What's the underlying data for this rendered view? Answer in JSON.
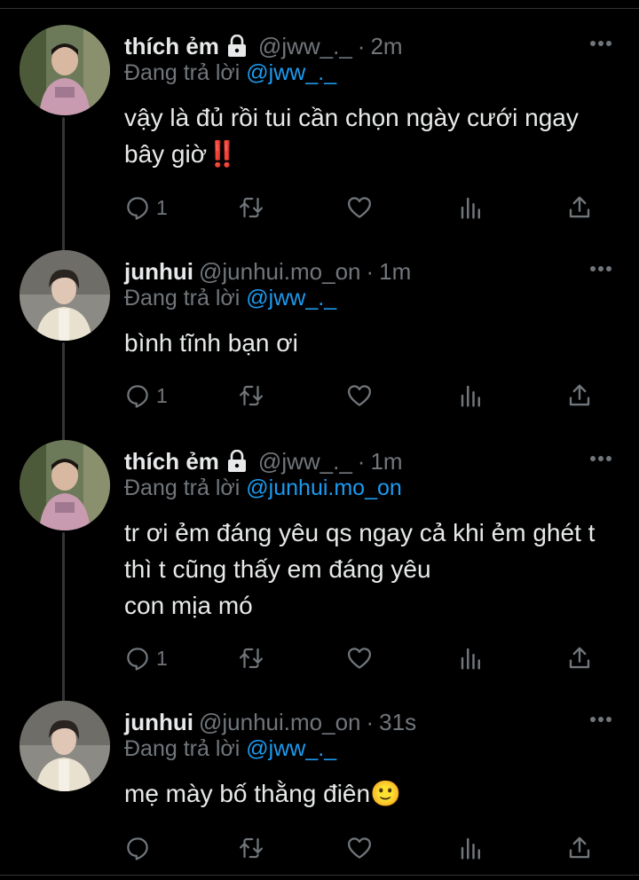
{
  "tweets": [
    {
      "name": "thích ẻm",
      "locked": true,
      "handle": "@jww_._",
      "dot": "·",
      "time": "2m",
      "reply_prefix": "Đang trả lời",
      "reply_to": "@jww_._",
      "lines": [
        "vậy là đủ rồi tui cần chọn ngày cưới ngay",
        "bây giờ‼️"
      ],
      "reply_count": "1",
      "avatar": "boy-avatar"
    },
    {
      "name": "junhui",
      "locked": false,
      "handle": "@junhui.mo_on",
      "dot": "·",
      "time": "1m",
      "reply_prefix": "Đang trả lời",
      "reply_to": "@jww_._",
      "lines": [
        "bình tĩnh bạn ơi"
      ],
      "reply_count": "1",
      "avatar": "junhui-avatar"
    },
    {
      "name": "thích ẻm",
      "locked": true,
      "handle": "@jww_._",
      "dot": "·",
      "time": "1m",
      "reply_prefix": "Đang trả lời",
      "reply_to": "@junhui.mo_on",
      "lines": [
        "tr ơi ẻm đáng yêu qs ngay cả khi ẻm ghét t",
        "thì t cũng thấy em đáng yêu",
        "con mịa mó"
      ],
      "reply_count": "1",
      "avatar": "boy-avatar"
    },
    {
      "name": "junhui",
      "locked": false,
      "handle": "@junhui.mo_on",
      "dot": "·",
      "time": "31s",
      "reply_prefix": "Đang trả lời",
      "reply_to": "@jww_._",
      "lines": [
        "mẹ mày bố thằng điên🙂"
      ],
      "reply_count": "",
      "avatar": "junhui-avatar"
    }
  ],
  "colors": {
    "background": "#000000",
    "text": "#e7e9ea",
    "muted": "#71767b",
    "link": "#1d9bf0",
    "divider": "#2f3336"
  },
  "icons": [
    "reply-icon",
    "retweet-icon",
    "like-icon",
    "views-icon",
    "share-icon",
    "more-icon",
    "lock-icon"
  ]
}
